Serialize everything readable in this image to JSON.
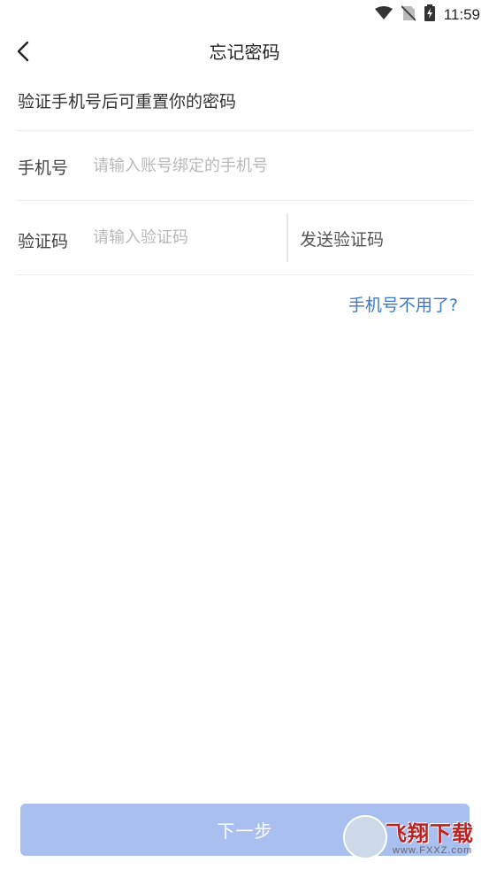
{
  "status_bar": {
    "time": "11:59"
  },
  "header": {
    "title": "忘记密码"
  },
  "hint": "验证手机号后可重置你的密码",
  "phone_row": {
    "label": "手机号",
    "placeholder": "请输入账号绑定的手机号",
    "value": ""
  },
  "code_row": {
    "label": "验证码",
    "placeholder": "请输入验证码",
    "value": "",
    "send_label": "发送验证码"
  },
  "forgot_link": "手机号不用了?",
  "next_button": "下一步",
  "watermark": {
    "text": "飞翔下载",
    "url": "www.FXXZ.com"
  },
  "colors": {
    "link": "#3b78c8",
    "button_disabled": "#a8bff0"
  }
}
